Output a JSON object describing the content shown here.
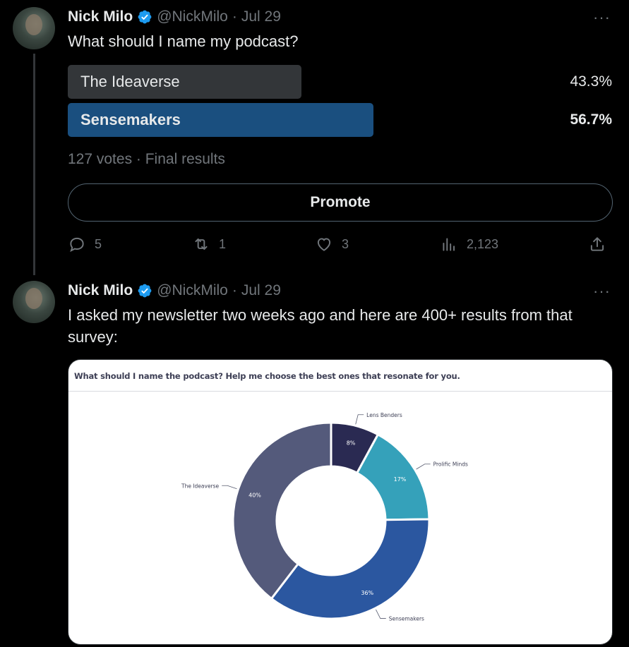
{
  "tweet1": {
    "name": "Nick Milo",
    "handle": "@NickMilo",
    "dot": "·",
    "date": "Jul 29",
    "more": "···",
    "text": "What should I name my podcast?",
    "poll": {
      "options": [
        {
          "label": "The Ideaverse",
          "percent_text": "43.3%",
          "percent": 43.3,
          "winner": false
        },
        {
          "label": "Sensemakers",
          "percent_text": "56.7%",
          "percent": 56.7,
          "winner": true
        }
      ],
      "meta": "127 votes · Final results"
    },
    "promote_label": "Promote",
    "actions": {
      "replies": "5",
      "retweets": "1",
      "likes": "3",
      "views": "2,123"
    }
  },
  "tweet2": {
    "name": "Nick Milo",
    "handle": "@NickMilo",
    "dot": "·",
    "date": "Jul 29",
    "more": "···",
    "text": "I asked my newsletter two weeks ago and here are 400+ results from that survey:"
  },
  "colors": {
    "background": "#000000",
    "verified": "#1d9bf0",
    "poll_winner": "#1a4f7f",
    "poll_loser": "#333639",
    "muted": "#71767b"
  },
  "chart_data": {
    "type": "pie",
    "title": "What should I name the podcast? Help me choose the best ones that resonate for you.",
    "donut": true,
    "categories": [
      "Lens Benders",
      "Prolific Minds",
      "Sensemakers",
      "The Ideaverse"
    ],
    "values": [
      8,
      17,
      36,
      40
    ],
    "labels": [
      "8%",
      "17%",
      "36%",
      "40%"
    ],
    "colors": [
      "#2a2a52",
      "#35a1ba",
      "#2b57a0",
      "#545a7b"
    ]
  }
}
